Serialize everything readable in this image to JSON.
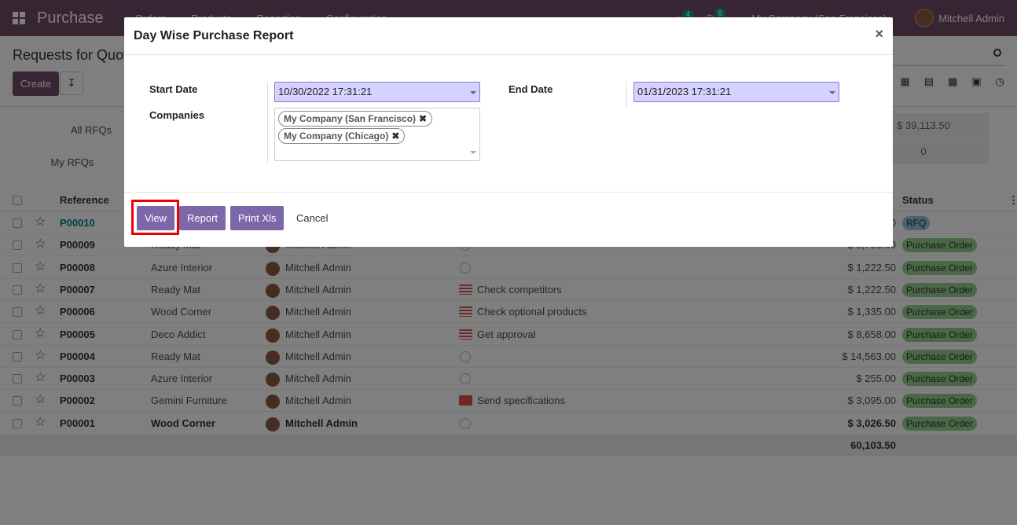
{
  "app": {
    "name": "Purchase",
    "menu": [
      "Orders",
      "Products",
      "Reporting",
      "Configuration"
    ]
  },
  "systray": {
    "messages_count": "4",
    "activities_count": "8",
    "company": "My Company (San Francisco)",
    "user": "Mitchell Admin"
  },
  "page": {
    "breadcrumb": "Requests for Quotation",
    "create_label": "Create"
  },
  "dashboard": {
    "all_rfqs": "All RFQs",
    "my_rfqs": "My RFQs",
    "total": "$ 39,113.50",
    "count": "0"
  },
  "table": {
    "headers": {
      "reference": "Reference",
      "status": "Status"
    },
    "rows": [
      {
        "ref": "P00010",
        "vendor": "",
        "user": "",
        "activity": "",
        "icon": "",
        "amount": "0",
        "status": "RFQ",
        "status_color": "#8ec5e0"
      },
      {
        "ref": "P00009",
        "vendor": "Ready Mat",
        "user": "Mitchell Admin",
        "activity": "",
        "icon": "clock",
        "amount": "$ 5,736.00",
        "status": "Purchase Order",
        "status_color": "#92d08d"
      },
      {
        "ref": "P00008",
        "vendor": "Azure Interior",
        "user": "Mitchell Admin",
        "activity": "",
        "icon": "clock",
        "amount": "$ 1,222.50",
        "status": "Purchase Order",
        "status_color": "#92d08d"
      },
      {
        "ref": "P00007",
        "vendor": "Ready Mat",
        "user": "Mitchell Admin",
        "activity": "Check competitors",
        "icon": "list",
        "amount": "$ 1,222.50",
        "status": "Purchase Order",
        "status_color": "#92d08d"
      },
      {
        "ref": "P00006",
        "vendor": "Wood Corner",
        "user": "Mitchell Admin",
        "activity": "Check optional products",
        "icon": "list",
        "amount": "$ 1,335.00",
        "status": "Purchase Order",
        "status_color": "#92d08d"
      },
      {
        "ref": "P00005",
        "vendor": "Deco Addict",
        "user": "Mitchell Admin",
        "activity": "Get approval",
        "icon": "list",
        "amount": "$ 8,658.00",
        "status": "Purchase Order",
        "status_color": "#92d08d"
      },
      {
        "ref": "P00004",
        "vendor": "Ready Mat",
        "user": "Mitchell Admin",
        "activity": "",
        "icon": "clock",
        "amount": "$ 14,563.00",
        "status": "Purchase Order",
        "status_color": "#92d08d"
      },
      {
        "ref": "P00003",
        "vendor": "Azure Interior",
        "user": "Mitchell Admin",
        "activity": "",
        "icon": "clock",
        "amount": "$ 255.00",
        "status": "Purchase Order",
        "status_color": "#92d08d"
      },
      {
        "ref": "P00002",
        "vendor": "Gemini Furniture",
        "user": "Mitchell Admin",
        "activity": "Send specifications",
        "icon": "mail",
        "amount": "$ 3,095.00",
        "status": "Purchase Order",
        "status_color": "#92d08d"
      },
      {
        "ref": "P00001",
        "vendor": "Wood Corner",
        "user": "Mitchell Admin",
        "activity": "",
        "icon": "clock",
        "amount": "$ 3,026.50",
        "status": "Purchase Order",
        "status_color": "#92d08d",
        "bold": true
      }
    ],
    "total": "60,103.50"
  },
  "modal": {
    "title": "Day Wise Purchase Report",
    "close": "×",
    "start_date_label": "Start Date",
    "start_date_value": "10/30/2022 17:31:21",
    "end_date_label": "End Date",
    "end_date_value": "01/31/2023 17:31:21",
    "companies_label": "Companies",
    "companies": [
      "My Company (San Francisco)",
      "My Company (Chicago)"
    ],
    "buttons": {
      "view": "View",
      "report": "Report",
      "print": "Print Xls",
      "cancel": "Cancel"
    }
  },
  "colors": {
    "brand": "#714b67",
    "button": "#7c68a8",
    "date_bg": "#d6d2ff",
    "highlight": "#e00000",
    "activity_red": "#d9534f"
  }
}
